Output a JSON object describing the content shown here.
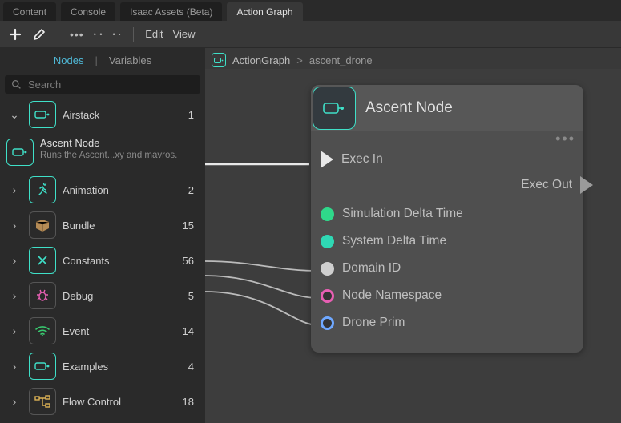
{
  "tabs": [
    "Content",
    "Console",
    "Isaac Assets (Beta)",
    "Action Graph"
  ],
  "active_tab": "Action Graph",
  "toolbar": {
    "edit": "Edit",
    "view": "View"
  },
  "subtabs": {
    "nodes": "Nodes",
    "variables": "Variables"
  },
  "search": {
    "placeholder": "Search"
  },
  "categories": [
    {
      "label": "Airstack",
      "count": 1,
      "icon": "node-icon",
      "expanded": true,
      "accent": true
    },
    {
      "label": "Animation",
      "count": 2,
      "icon": "run-icon",
      "expanded": false,
      "accent": true
    },
    {
      "label": "Bundle",
      "count": 15,
      "icon": "box-icon",
      "expanded": false,
      "accent": false
    },
    {
      "label": "Constants",
      "count": 56,
      "icon": "x-icon",
      "expanded": false,
      "accent": true
    },
    {
      "label": "Debug",
      "count": 5,
      "icon": "bug-icon",
      "expanded": false,
      "accent": false
    },
    {
      "label": "Event",
      "count": 14,
      "icon": "wifi-icon",
      "expanded": false,
      "accent": false
    },
    {
      "label": "Examples",
      "count": 4,
      "icon": "node-icon",
      "expanded": false,
      "accent": true
    },
    {
      "label": "Flow Control",
      "count": 18,
      "icon": "flow-icon",
      "expanded": false,
      "accent": false
    }
  ],
  "node_item": {
    "name": "Ascent Node",
    "desc": "Runs the Ascent...xy and mavros."
  },
  "breadcrumb": {
    "root": "ActionGraph",
    "current": "ascent_drone"
  },
  "graph_node": {
    "title": "Ascent Node",
    "exec_in": "Exec In",
    "exec_out": "Exec Out",
    "inputs": [
      {
        "label": "Simulation Delta Time",
        "color": "g-green"
      },
      {
        "label": "System Delta Time",
        "color": "g-green2"
      },
      {
        "label": "Domain ID",
        "color": "g-grey"
      },
      {
        "label": "Node Namespace",
        "color": "g-mag"
      },
      {
        "label": "Drone Prim",
        "color": "g-blue"
      }
    ]
  }
}
